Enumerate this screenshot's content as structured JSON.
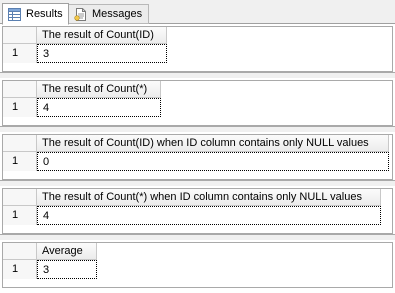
{
  "tabs": {
    "results_label": "Results",
    "messages_label": "Messages"
  },
  "grids": [
    {
      "column_header": "The result of Count(ID)",
      "row_number": "1",
      "value": "3"
    },
    {
      "column_header": "The result of Count(*)",
      "row_number": "1",
      "value": "4"
    },
    {
      "column_header": "The result of Count(ID) when ID column contains only NULL values",
      "row_number": "1",
      "value": "0"
    },
    {
      "column_header": "The result of Count(*) when ID column contains only NULL values",
      "row_number": "1",
      "value": "4"
    },
    {
      "column_header": "Average",
      "row_number": "1",
      "value": "3"
    }
  ],
  "icons": {
    "results_tab": "grid-icon",
    "messages_tab": "message-document-icon"
  }
}
